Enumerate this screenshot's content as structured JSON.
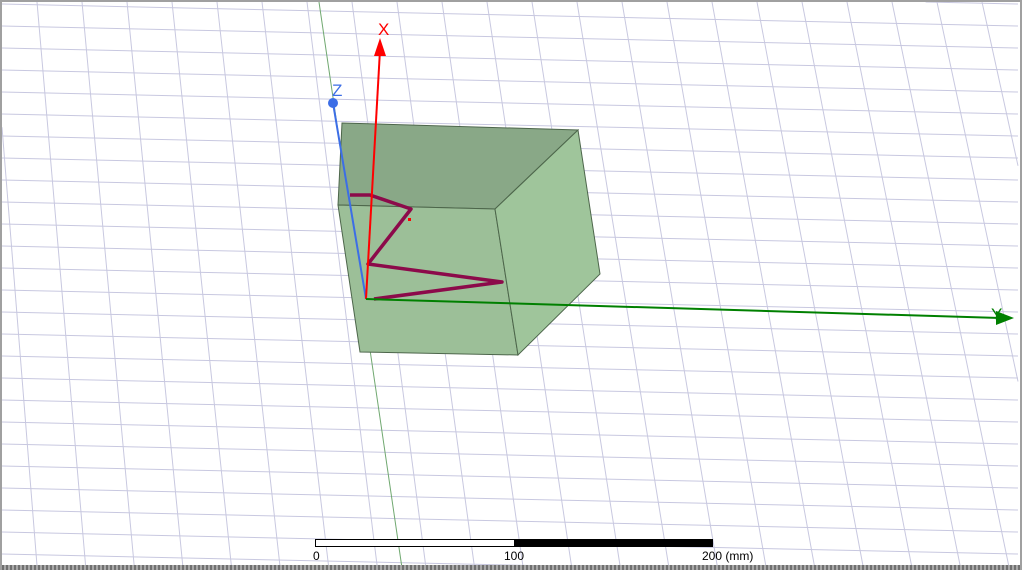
{
  "viewport": {
    "axes": {
      "x_label": "X",
      "y_label": "Y",
      "z_label": "Z",
      "x_color": "#ff0000",
      "y_color": "#008000",
      "z_color": "#3c6ee6"
    },
    "box_color": "#9cbf98",
    "trace_color": "#8c0a4a"
  },
  "scale_bar": {
    "ticks": [
      "0",
      "100",
      "200 (mm)"
    ]
  }
}
